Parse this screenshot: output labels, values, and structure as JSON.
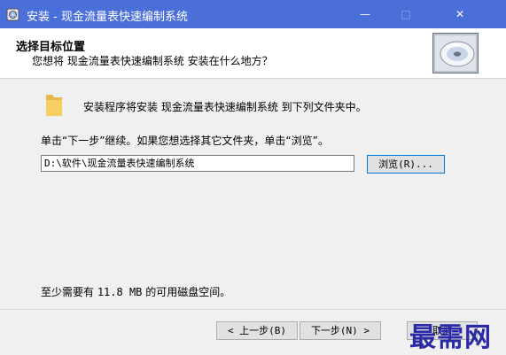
{
  "window": {
    "title": "安装 - 现金流量表快速编制系统",
    "minimize_glyph": "—",
    "maximize_glyph": "□",
    "close_glyph": "✕"
  },
  "header": {
    "title": "选择目标位置",
    "subtitle": "您想将 现金流量表快速编制系统 安装在什么地方？",
    "image_icon": "cd-disc-icon"
  },
  "content": {
    "folder_icon": "folder-icon",
    "info_text": "安装程序将安装 现金流量表快速编制系统 到下列文件夹中。",
    "instruction_text": "单击“下一步”继续。如果您想选择其它文件夹，单击“浏览”。",
    "install_path": "D:\\软件\\现金流量表快速编制系统",
    "browse_label": "浏览(R)...",
    "space_prefix": "至少需要有 ",
    "space_value": "11.8 MB",
    "space_suffix": " 的可用磁盘空间。"
  },
  "footer": {
    "back_label": "< 上一步(B)",
    "next_label": "下一步(N) >",
    "cancel_label": "取消"
  },
  "watermark": "最需网",
  "colors": {
    "titlebar": "#4a6fd8",
    "dialog_bg": "#f0f0f0",
    "watermark": "#2a2aa6"
  }
}
